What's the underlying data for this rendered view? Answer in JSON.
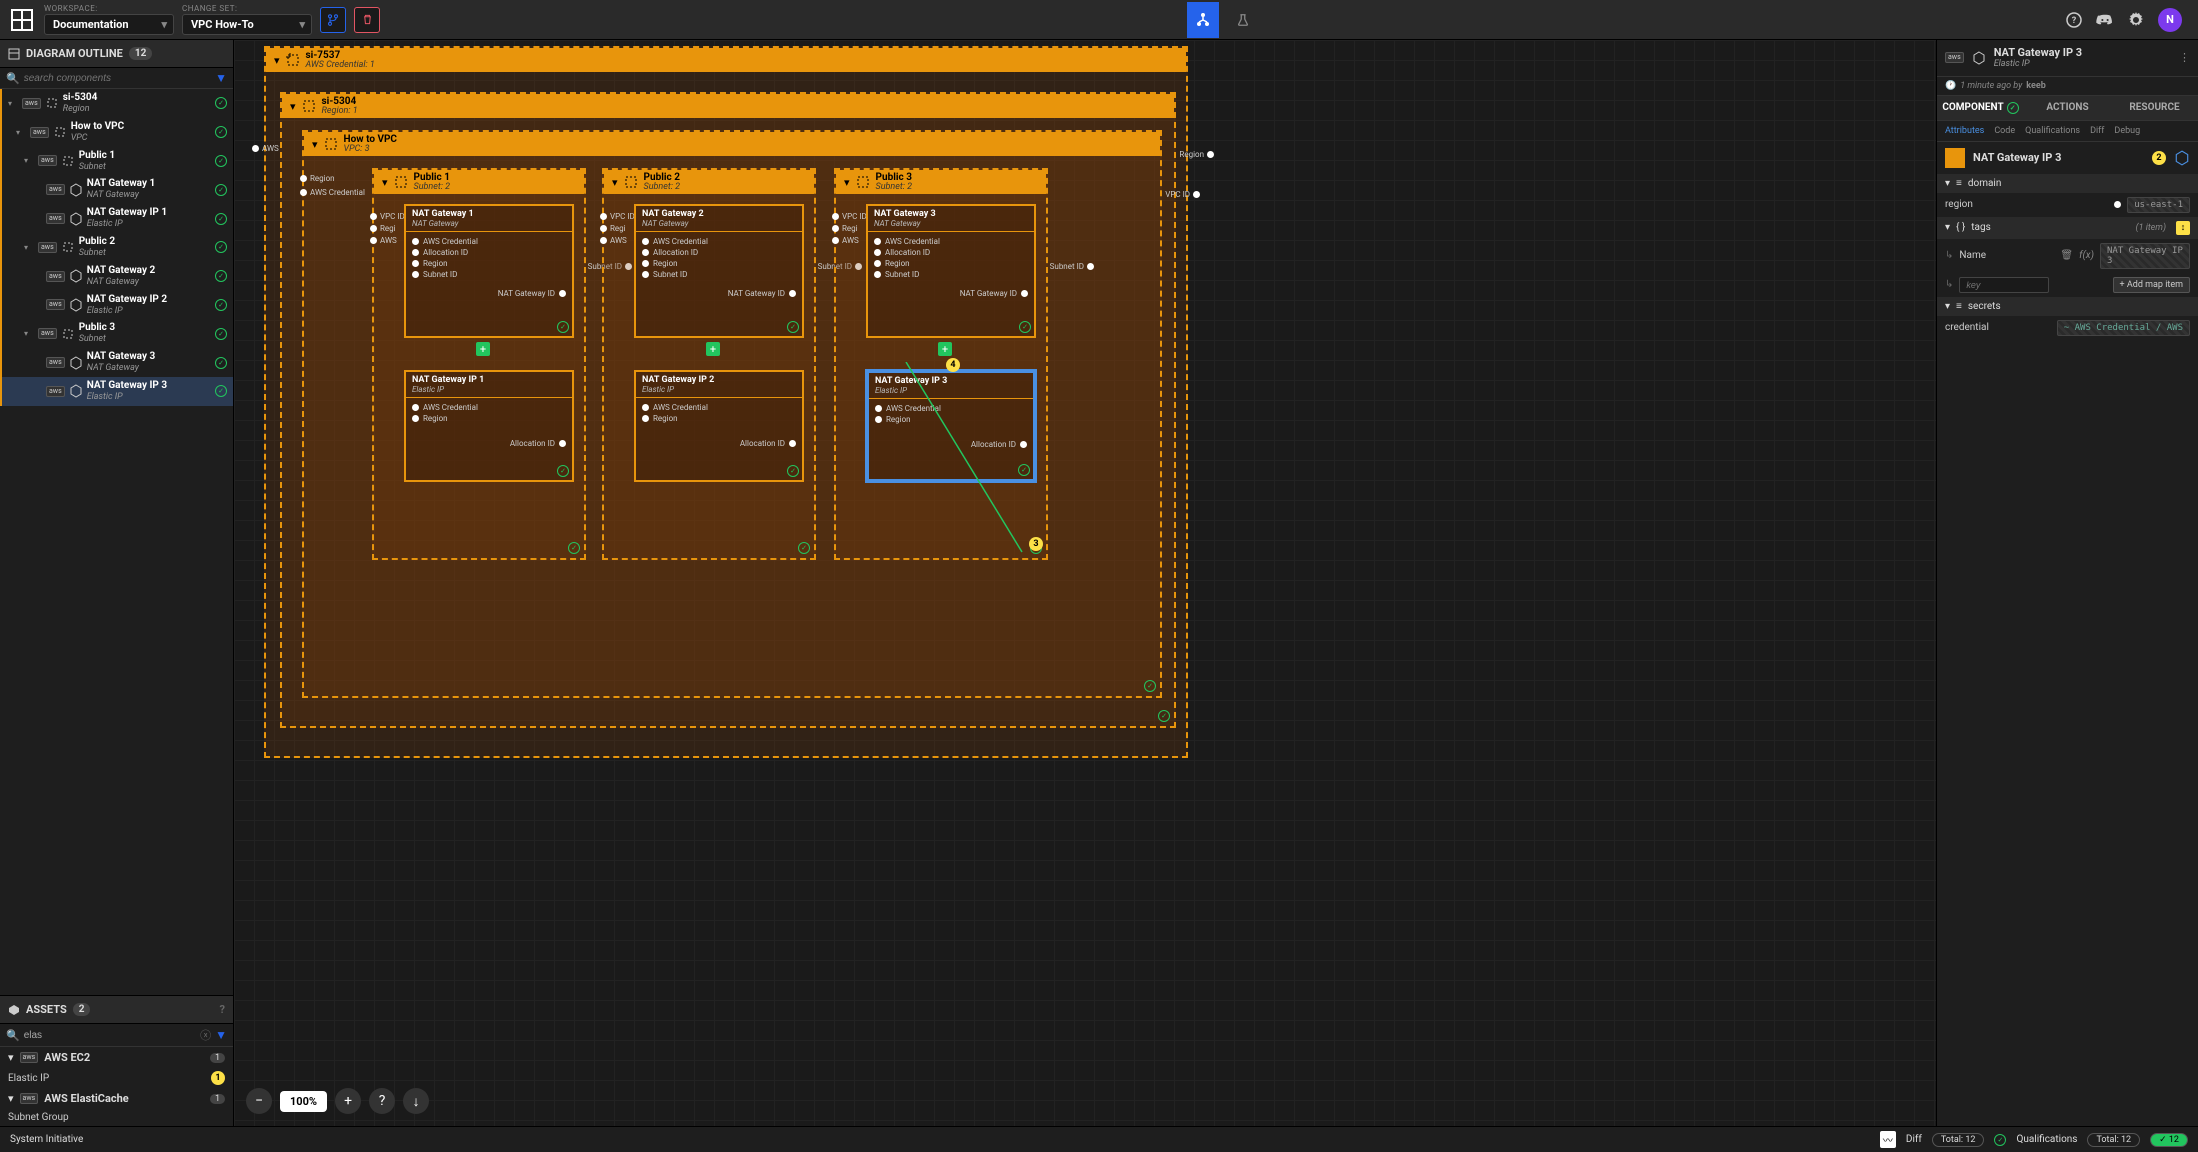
{
  "topbar": {
    "workspace_label": "WORKSPACE:",
    "workspace_value": "Documentation",
    "changeset_label": "CHANGE SET:",
    "changeset_value": "VPC How-To",
    "avatar_letter": "N"
  },
  "outline": {
    "header": "DIAGRAM OUTLINE",
    "count": "12",
    "search_placeholder": "search components",
    "items": [
      {
        "indent": 0,
        "title": "si-5304",
        "sub": "Region",
        "icon": "frame"
      },
      {
        "indent": 1,
        "title": "How to VPC",
        "sub": "VPC",
        "icon": "frame"
      },
      {
        "indent": 2,
        "title": "Public 1",
        "sub": "Subnet",
        "icon": "frame"
      },
      {
        "indent": 3,
        "title": "NAT Gateway 1",
        "sub": "NAT Gateway",
        "icon": "hex"
      },
      {
        "indent": 3,
        "title": "NAT Gateway IP 1",
        "sub": "Elastic IP",
        "icon": "hex"
      },
      {
        "indent": 2,
        "title": "Public 2",
        "sub": "Subnet",
        "icon": "frame"
      },
      {
        "indent": 3,
        "title": "NAT Gateway 2",
        "sub": "NAT Gateway",
        "icon": "hex"
      },
      {
        "indent": 3,
        "title": "NAT Gateway IP 2",
        "sub": "Elastic IP",
        "icon": "hex"
      },
      {
        "indent": 2,
        "title": "Public 3",
        "sub": "Subnet",
        "icon": "frame"
      },
      {
        "indent": 3,
        "title": "NAT Gateway 3",
        "sub": "NAT Gateway",
        "icon": "hex"
      },
      {
        "indent": 3,
        "title": "NAT Gateway IP 3",
        "sub": "Elastic IP",
        "icon": "hex",
        "selected": true
      }
    ]
  },
  "assets": {
    "header": "ASSETS",
    "count": "2",
    "search_value": "elas",
    "cats": [
      {
        "name": "AWS EC2",
        "count": "1",
        "items": [
          {
            "name": "Elastic IP",
            "callout": "1"
          }
        ]
      },
      {
        "name": "AWS ElastiCache",
        "count": "1",
        "items": [
          {
            "name": "Subnet Group"
          }
        ]
      }
    ]
  },
  "canvas": {
    "zoom": "100%",
    "frames": {
      "si7537": {
        "title": "si-7537",
        "sub": "AWS Credential: 1"
      },
      "si5304": {
        "title": "si-5304",
        "sub": "Region: 1"
      },
      "howtovpc": {
        "title": "How to VPC",
        "sub": "VPC: 3"
      },
      "region_label": "Region",
      "awscred_label": "AWS Credential",
      "aws_short": "AWS",
      "region_side": "Region",
      "vpcid_label": "VPC ID",
      "subnets": [
        {
          "title": "Public 1",
          "sub": "Subnet: 2"
        },
        {
          "title": "Public 2",
          "sub": "Subnet: 2"
        },
        {
          "title": "Public 3",
          "sub": "Subnet: 2"
        }
      ],
      "subnet_sockets": {
        "vpcid": "VPC ID",
        "region": "Region",
        "aws": "AWS",
        "subnetid": "Subnet ID"
      },
      "nat_sockets": [
        "AWS Credential",
        "Allocation ID",
        "Region",
        "Subnet ID"
      ],
      "nat_out": "NAT Gateway ID",
      "ip_sockets": [
        "AWS Credential",
        "Region"
      ],
      "ip_out": "Allocation ID",
      "gateways": [
        {
          "title": "NAT Gateway 1",
          "sub": "NAT Gateway"
        },
        {
          "title": "NAT Gateway 2",
          "sub": "NAT Gateway"
        },
        {
          "title": "NAT Gateway 3",
          "sub": "NAT Gateway"
        }
      ],
      "ips": [
        {
          "title": "NAT Gateway IP 1",
          "sub": "Elastic IP"
        },
        {
          "title": "NAT Gateway IP 2",
          "sub": "Elastic IP"
        },
        {
          "title": "NAT Gateway IP 3",
          "sub": "Elastic IP"
        }
      ],
      "callouts": {
        "c2": "2",
        "c3": "3",
        "c4": "4"
      }
    }
  },
  "right": {
    "aws_label": "aws",
    "title": "NAT Gateway IP 3",
    "sub": "Elastic IP",
    "meta_time": "1 minute ago by",
    "meta_user": "keeb",
    "tabs": [
      "COMPONENT",
      "ACTIONS",
      "RESOURCE"
    ],
    "subtabs": [
      "Attributes",
      "Code",
      "Qualifications",
      "Diff",
      "Debug"
    ],
    "box_title": "NAT Gateway IP 3",
    "domain": "domain",
    "region_label": "region",
    "region_value": "us-east-1",
    "tags_label": "tags",
    "tags_count": "(1 item)",
    "tag_name_label": "Name",
    "tag_name_value": "NAT Gateway IP 3",
    "key_placeholder": "key",
    "add_map": "+ Add map item",
    "secrets_label": "secrets",
    "credential_label": "credential",
    "credential_value": "~ AWS Credential / AWS"
  },
  "statusbar": {
    "brand": "System Initiative",
    "diff": "Diff",
    "total": "Total: 12",
    "qual": "Qualifications",
    "qual_total": "Total: 12",
    "qual_ok": "12"
  }
}
